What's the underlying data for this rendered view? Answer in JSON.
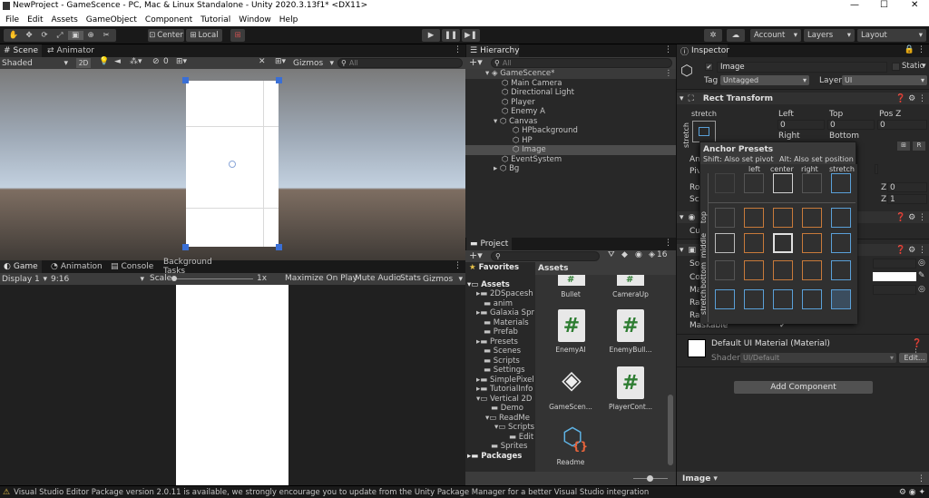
{
  "window": {
    "title": "NewProject - GameScence - PC, Mac & Linux Standalone - Unity 2020.3.13f1* <DX11>",
    "minimize": "—",
    "maximize": "☐",
    "close": "✕"
  },
  "menu": [
    "File",
    "Edit",
    "Assets",
    "GameObject",
    "Component",
    "Tutorial",
    "Window",
    "Help"
  ],
  "toolbar": {
    "center": "Center",
    "local": "Local",
    "account": "Account",
    "layers": "Layers",
    "layout": "Layout"
  },
  "scene": {
    "tab_scene": "Scene",
    "tab_animator": "Animator",
    "shading": "Shaded",
    "mode2d": "2D",
    "fx_count": "0",
    "gizmos": "Gizmos",
    "search_placeholder": "All"
  },
  "game": {
    "tab_game": "Game",
    "tab_animation": "Animation",
    "tab_console": "Console",
    "tab_bg": "Background Tasks",
    "display": "Display 1",
    "aspect": "9:16",
    "scale_label": "Scale",
    "scale_value": "1x",
    "maximize": "Maximize On Play",
    "mute": "Mute Audio",
    "stats": "Stats",
    "gizmos": "Gizmos"
  },
  "hierarchy": {
    "tab": "Hierarchy",
    "search_placeholder": "All",
    "items": [
      "GameScence*",
      "Main Camera",
      "Directional Light",
      "Player",
      "Enemy A",
      "Canvas",
      "HPbackground",
      "HP",
      "Image",
      "EventSystem",
      "Bg"
    ]
  },
  "project": {
    "tab": "Project",
    "badge": "16",
    "favorites": "Favorites",
    "assets_header": "Assets",
    "folders": [
      "Assets",
      "2DSpacesh",
      "anim",
      "Galaxia Spr",
      "Materials",
      "Prefab",
      "Presets",
      "Scenes",
      "Scripts",
      "Settings",
      "SimplePixel",
      "TutorialInfo",
      "Vertical 2D",
      "Demo",
      "ReadMe",
      "Scripts",
      "Edit",
      "Sprites",
      "Packages"
    ],
    "assets": [
      "Bullet",
      "CameraUp",
      "EnemyAI",
      "EnemyBull...",
      "GameScen...",
      "PlayerCont...",
      "Readme"
    ]
  },
  "inspector": {
    "tab": "Inspector",
    "object_name": "Image",
    "static": "Static",
    "tag_label": "Tag",
    "tag_value": "Untagged",
    "layer_label": "Layer",
    "layer_value": "UI",
    "rect_transform": "Rect Transform",
    "stretch": "stretch",
    "left": "Left",
    "top": "Top",
    "posz": "Pos Z",
    "left_v": "0",
    "top_v": "0",
    "posz_v": "0",
    "right": "Right",
    "bottom": "Bottom",
    "anchor_title": "Anchor Presets",
    "anchor_shift": "Shift: Also set pivot",
    "anchor_alt": "Alt: Also set position",
    "col_left": "left",
    "col_center": "center",
    "col_right": "right",
    "col_stretch": "stretch",
    "row_top": "top",
    "row_middle": "middle",
    "row_bottom": "bottom",
    "row_stretch": "stretch",
    "trunc": [
      "An",
      "Piv",
      "Ro",
      "Sc",
      "Cu",
      "So",
      "Co",
      "Ma",
      "Ra",
      "Ra"
    ],
    "z1": "Z",
    "z1v": "0",
    "z2": "Z",
    "z2v": "1",
    "maskable": "Maskable",
    "material": "Default UI Material (Material)",
    "shader_label": "Shader",
    "shader_value": "UI/Default",
    "edit": "Edit...",
    "add_component": "Add Component",
    "footer": "Image"
  },
  "status": {
    "message": "Visual Studio Editor Package version 2.0.11 is available, we strongly encourage you to update from the Unity Package Manager for a better Visual Studio integration"
  }
}
